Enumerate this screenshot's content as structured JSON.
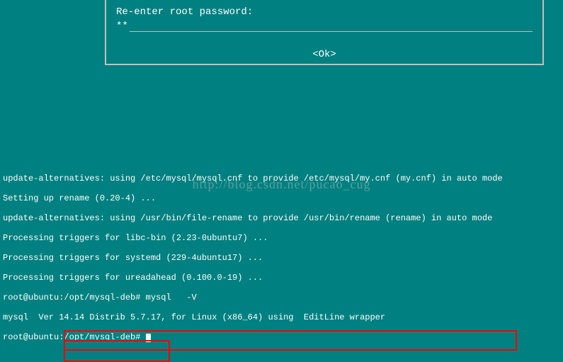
{
  "dialog": {
    "prompt": "Re-enter root password:",
    "masked_value": "**",
    "ok_label": "<Ok>"
  },
  "watermark": {
    "text": "http://blog.csdn.net/pucao_cug"
  },
  "terminal": {
    "lines": [
      "update-alternatives: using /etc/mysql/mysql.cnf to provide /etc/mysql/my.cnf (my.cnf) in auto mode",
      "Setting up rename (0.20-4) ...",
      "update-alternatives: using /usr/bin/file-rename to provide /usr/bin/rename (rename) in auto mode",
      "Processing triggers for libc-bin (2.23-0ubuntu7) ...",
      "Processing triggers for systemd (229-4ubuntu17) ...",
      "Processing triggers for ureadahead (0.100.0-19) ..."
    ],
    "prompt1_user_host": "root@ubuntu",
    "prompt1_path": ":/opt/mysql-deb#",
    "command1": " mysql   -V",
    "version_output": "mysql  Ver 14.14 Distrib 5.7.17, for Linux (x86_64) using  EditLine wrapper",
    "prompt2_user_host": "root@ubuntu",
    "prompt2_path": ":/opt/mysql-deb#",
    "command2": " "
  }
}
